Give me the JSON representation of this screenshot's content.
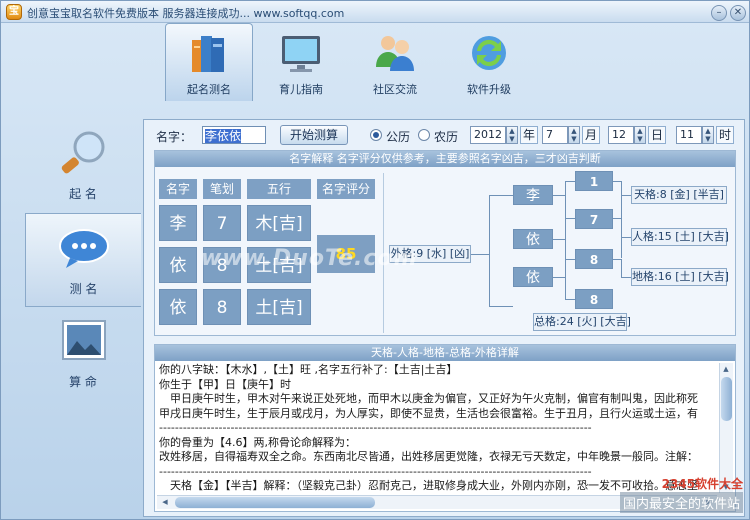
{
  "title": "创意宝宝取名软件免费版本 服务器连接成功... www.softqq.com",
  "window": {
    "minimize_label": "–",
    "close_label": "✕"
  },
  "toolbar": [
    {
      "label": "起名测名",
      "icon": "books-icon"
    },
    {
      "label": "育儿指南",
      "icon": "monitor-icon"
    },
    {
      "label": "社区交流",
      "icon": "users-icon"
    },
    {
      "label": "软件升级",
      "icon": "refresh-icon"
    }
  ],
  "sidebar": [
    {
      "label": "起 名",
      "icon": "magnifier-icon"
    },
    {
      "label": "测 名",
      "icon": "chat-bubble-icon"
    },
    {
      "label": "算 命",
      "icon": "picture-icon"
    }
  ],
  "form": {
    "name_label": "名字：",
    "name_value": "李依依",
    "start_button": "开始测算",
    "calendar_solar": "公历",
    "calendar_lunar": "农历",
    "year": "2012",
    "year_unit": "年",
    "month": "7",
    "month_unit": "月",
    "day": "12",
    "day_unit": "日",
    "hour": "11",
    "hour_unit": "时"
  },
  "analysis": {
    "header": "名字解释 名字评分仅供参考，主要参照名字凶吉，三才凶吉判断",
    "columns": [
      "名字",
      "笔划",
      "五行",
      "名字评分"
    ],
    "rows": [
      {
        "char": "李",
        "strokes": "7",
        "element": "木[吉]"
      },
      {
        "char": "依",
        "strokes": "8",
        "element": "土[吉]"
      },
      {
        "char": "依",
        "strokes": "8",
        "element": "土[吉]"
      }
    ],
    "score": "85",
    "outer_grid": "外格:9 [水] [凶]",
    "name_chars": [
      "李",
      "依",
      "依"
    ],
    "numbers": [
      "1",
      "7",
      "8",
      "8"
    ],
    "heaven_grid": "天格:8 [金] [半吉]",
    "person_grid": "人格:15 [土] [大吉]",
    "earth_grid": "地格:16 [土] [大吉]",
    "total_grid": "总格:24 [火] [大吉]"
  },
  "details": {
    "header": "天格-人格-地格-总格-外格详解",
    "lines": [
      "你的八字缺：【木水】,【土】旺 ,名字五行补了:【土吉|土吉】",
      "你生于【甲】日【庚午】时",
      "　甲日庚午时生，甲木对午来说正处死地，而甲木以庚金为偏官，又正好为午火克制，偏官有制叫鬼，因此称死",
      "甲戌日庚午时生，生于辰月或戌月，为人厚实，即使不显贵，生活也会很富裕。生于丑月，且行火运或土运，有",
      "-------------------------------------------------------------------------------------------------------------",
      "你的骨重为【4.6】两,称骨论命解释为：",
      "改姓移居，自得福寿双全之命。东西南北尽皆通，出姓移居更觉隆，衣禄无亏天数定，中年晚景一般同。注解：",
      "-------------------------------------------------------------------------------------------------------------",
      "　天格【金】【半吉】解释：（坚毅克己卦）忍耐克己，进取修身成大业，外刚内亦刚，恐一发不可收拾。意志坚"
    ]
  },
  "watermarks": {
    "center": "www.DuoTe.com",
    "corner_top": "2345软件大全",
    "corner_bottom": "国内最安全的软件站"
  },
  "colors": {
    "accent": "#7c9fc3",
    "score": "#ffd820",
    "header_bar": "#8ba9c9"
  }
}
